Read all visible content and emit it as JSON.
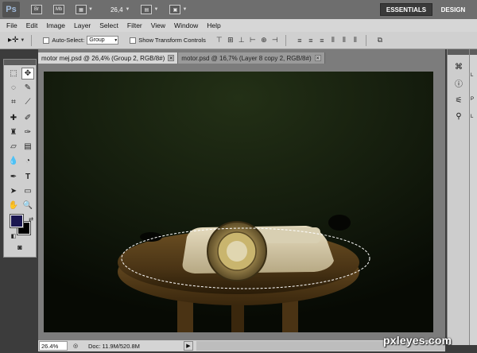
{
  "appbar": {
    "logo": "Ps",
    "br_label": "Br",
    "mb_label": "Mb",
    "zoom": "26,4",
    "workspaces": [
      "ESSENTIALS",
      "DESIGN"
    ],
    "active_workspace": "ESSENTIALS"
  },
  "menu": [
    "File",
    "Edit",
    "Image",
    "Layer",
    "Select",
    "Filter",
    "View",
    "Window",
    "Help"
  ],
  "options": {
    "auto_select_label": "Auto-Select:",
    "auto_select_value": "Group",
    "show_transform_label": "Show Transform Controls"
  },
  "tabs": [
    {
      "label": "motor mej.psd @ 26,4% (Group 2, RGB/8#)",
      "active": true
    },
    {
      "label": "motor.psd @ 16,7% (Layer 8 copy 2, RGB/8#)",
      "active": false
    }
  ],
  "tools": [
    "marquee-icon",
    "move-icon",
    "lasso-icon",
    "quick-select-icon",
    "crop-icon",
    "eyedropper-icon",
    "healing-icon",
    "brush-icon",
    "stamp-icon",
    "history-brush-icon",
    "eraser-icon",
    "gradient-icon",
    "blur-icon",
    "dodge-icon",
    "pen-icon",
    "type-icon",
    "path-select-icon",
    "shape-icon",
    "hand-icon",
    "zoom-icon"
  ],
  "colors": {
    "foreground": "#1a1650",
    "background": "#000000",
    "canvas_bg": "#0f1408"
  },
  "status": {
    "zoom": "26.4%",
    "doc": "Doc: 11.9M/520.8M"
  },
  "watermark": "pxleyes.com"
}
